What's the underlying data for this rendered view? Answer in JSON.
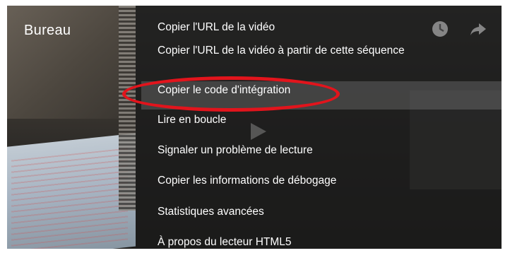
{
  "title": "Bureau",
  "menu": {
    "items": [
      {
        "label": "Copier l'URL de la vidéo"
      },
      {
        "label": "Copier l'URL de la vidéo à partir de cette séquence"
      },
      {
        "label": "Copier le code d'intégration",
        "annotated": true
      },
      {
        "label": "Lire en boucle"
      },
      {
        "label": "Signaler un problème de lecture"
      },
      {
        "label": "Copier les informations de débogage"
      },
      {
        "label": "Statistiques avancées"
      },
      {
        "label": "À propos du lecteur HTML5"
      }
    ]
  },
  "icons": [
    "clock-icon",
    "share-arrow-icon",
    "play-icon"
  ],
  "colors": {
    "annotation": "#e2141c",
    "menu_text": "#ffffff"
  }
}
